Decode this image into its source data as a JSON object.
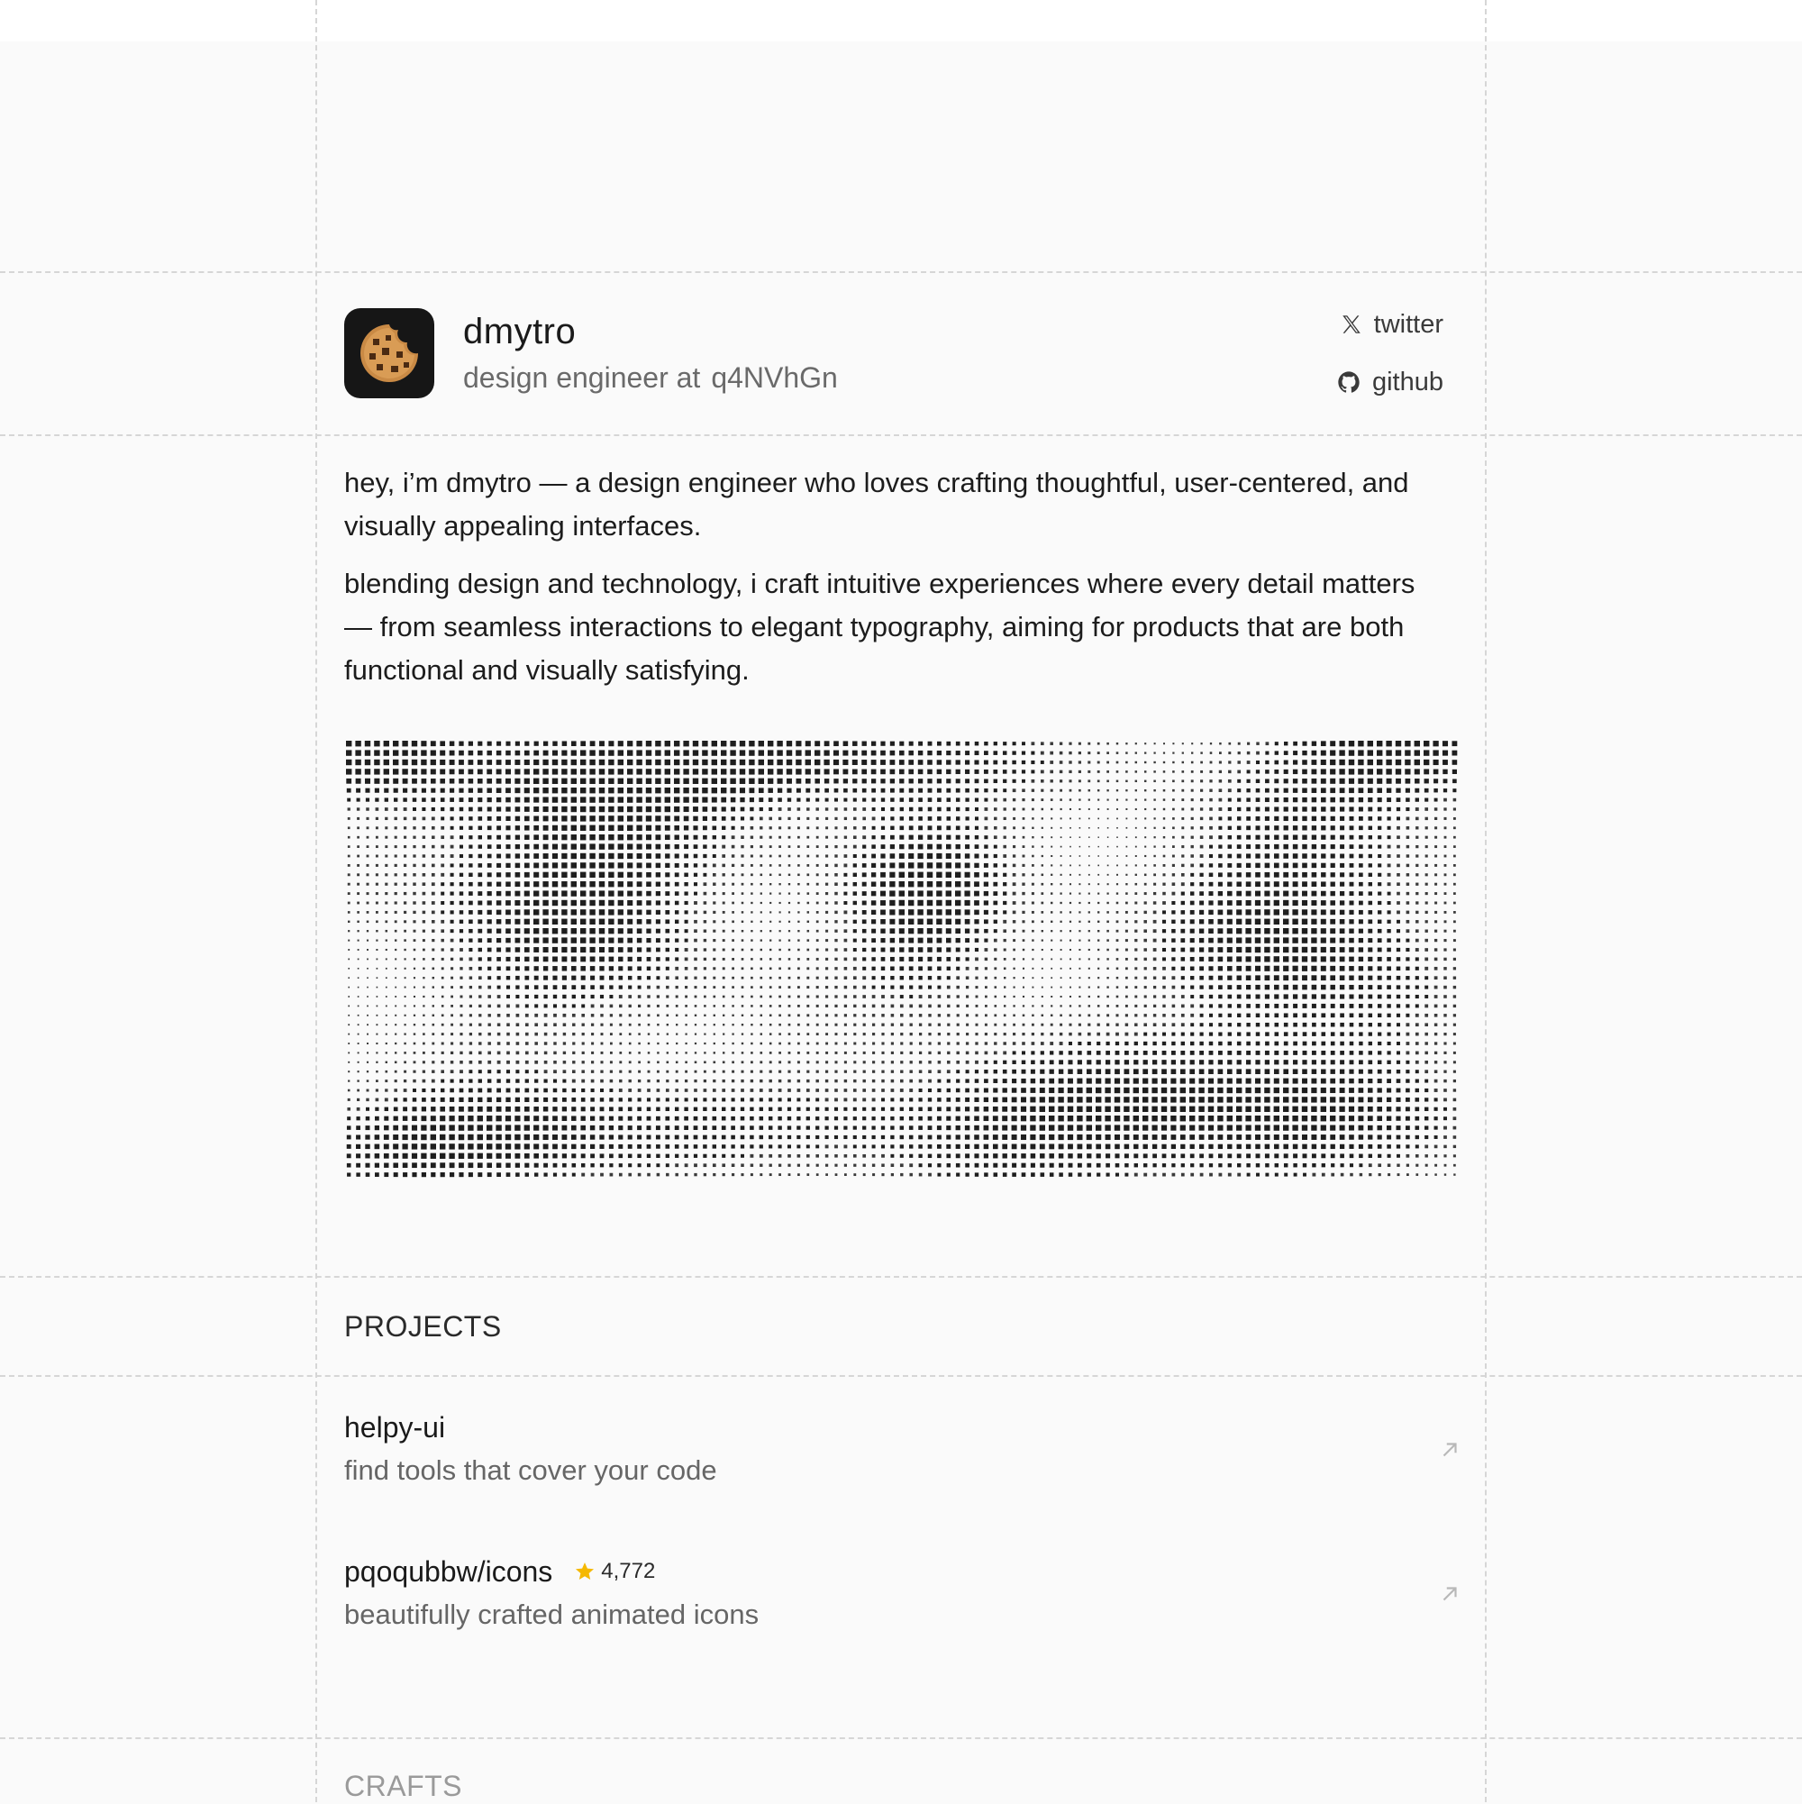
{
  "profile": {
    "name": "dmytro",
    "role": "design engineer at",
    "company": "q4NVhGn",
    "avatar_icon": "cookie-icon"
  },
  "social": {
    "twitter": {
      "label": "twitter",
      "icon": "x-logo-icon"
    },
    "github": {
      "label": "github",
      "icon": "github-logo-icon"
    }
  },
  "about": {
    "paragraph_1": "hey, i’m dmytro — a design engineer who loves crafting thoughtful, user-centered, and visually appealing interfaces.",
    "paragraph_2": "blending design and technology, i craft intuitive experiences where every detail matters — from seamless interactions to elegant typography, aiming for products that are both functional and visually satisfying."
  },
  "sections": {
    "projects": "PROJECTS",
    "crafts": "CRAFTS"
  },
  "projects": [
    {
      "title": "helpy-ui",
      "description": "find tools that cover your code",
      "stars": ""
    },
    {
      "title": "pqoqubbw/icons",
      "description": "beautifully crafted animated icons",
      "stars": "4,772"
    }
  ],
  "colors": {
    "background": "#fafafa",
    "grid_line": "#d6d6d6",
    "text_primary": "#1a1a1a",
    "text_secondary": "#6a6a6a",
    "star": "#f5b800"
  }
}
